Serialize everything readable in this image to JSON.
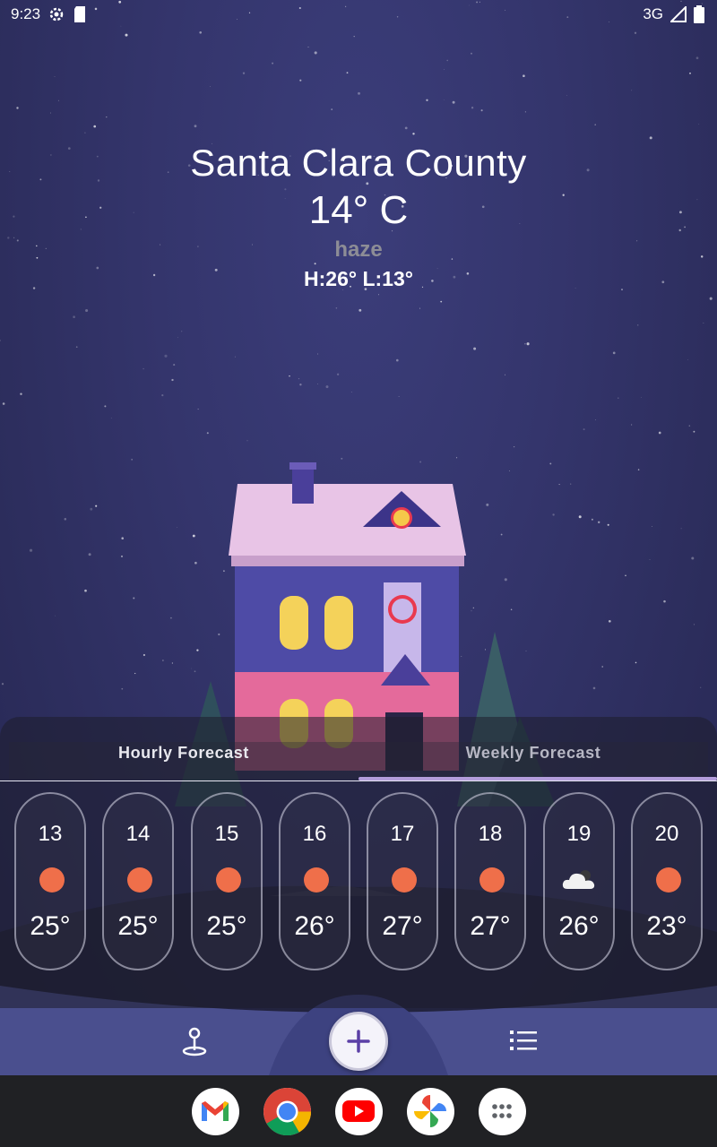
{
  "status_bar": {
    "time": "9:23",
    "network": "3G",
    "icons": [
      "settings-gear-icon",
      "sd-card-icon",
      "signal-icon",
      "battery-icon"
    ]
  },
  "weather": {
    "city": "Santa Clara County",
    "temperature": "14° C",
    "condition": "haze",
    "high_low": "H:26° L:13°"
  },
  "tabs": [
    {
      "label": "Hourly Forecast",
      "selected": false
    },
    {
      "label": "Weekly Forecast",
      "selected": true
    }
  ],
  "hourly": [
    {
      "hour": "13",
      "icon": "sun-icon",
      "temp": "25°"
    },
    {
      "hour": "14",
      "icon": "sun-icon",
      "temp": "25°"
    },
    {
      "hour": "15",
      "icon": "sun-icon",
      "temp": "25°"
    },
    {
      "hour": "16",
      "icon": "sun-icon",
      "temp": "26°"
    },
    {
      "hour": "17",
      "icon": "sun-icon",
      "temp": "27°"
    },
    {
      "hour": "18",
      "icon": "sun-icon",
      "temp": "27°"
    },
    {
      "hour": "19",
      "icon": "cloud-icon",
      "temp": "26°"
    },
    {
      "hour": "20",
      "icon": "sun-icon",
      "temp": "23°"
    }
  ],
  "actions": {
    "left_icon": "location-pin-icon",
    "center_icon": "plus-icon",
    "right_icon": "list-icon"
  },
  "dock": [
    "gmail-icon",
    "chrome-icon",
    "youtube-icon",
    "photos-icon",
    "app-drawer-icon"
  ],
  "colors": {
    "sun": "#ef6f4a",
    "tab_indicator": "#b39ddb",
    "accent_plus": "#5b3fa6"
  }
}
